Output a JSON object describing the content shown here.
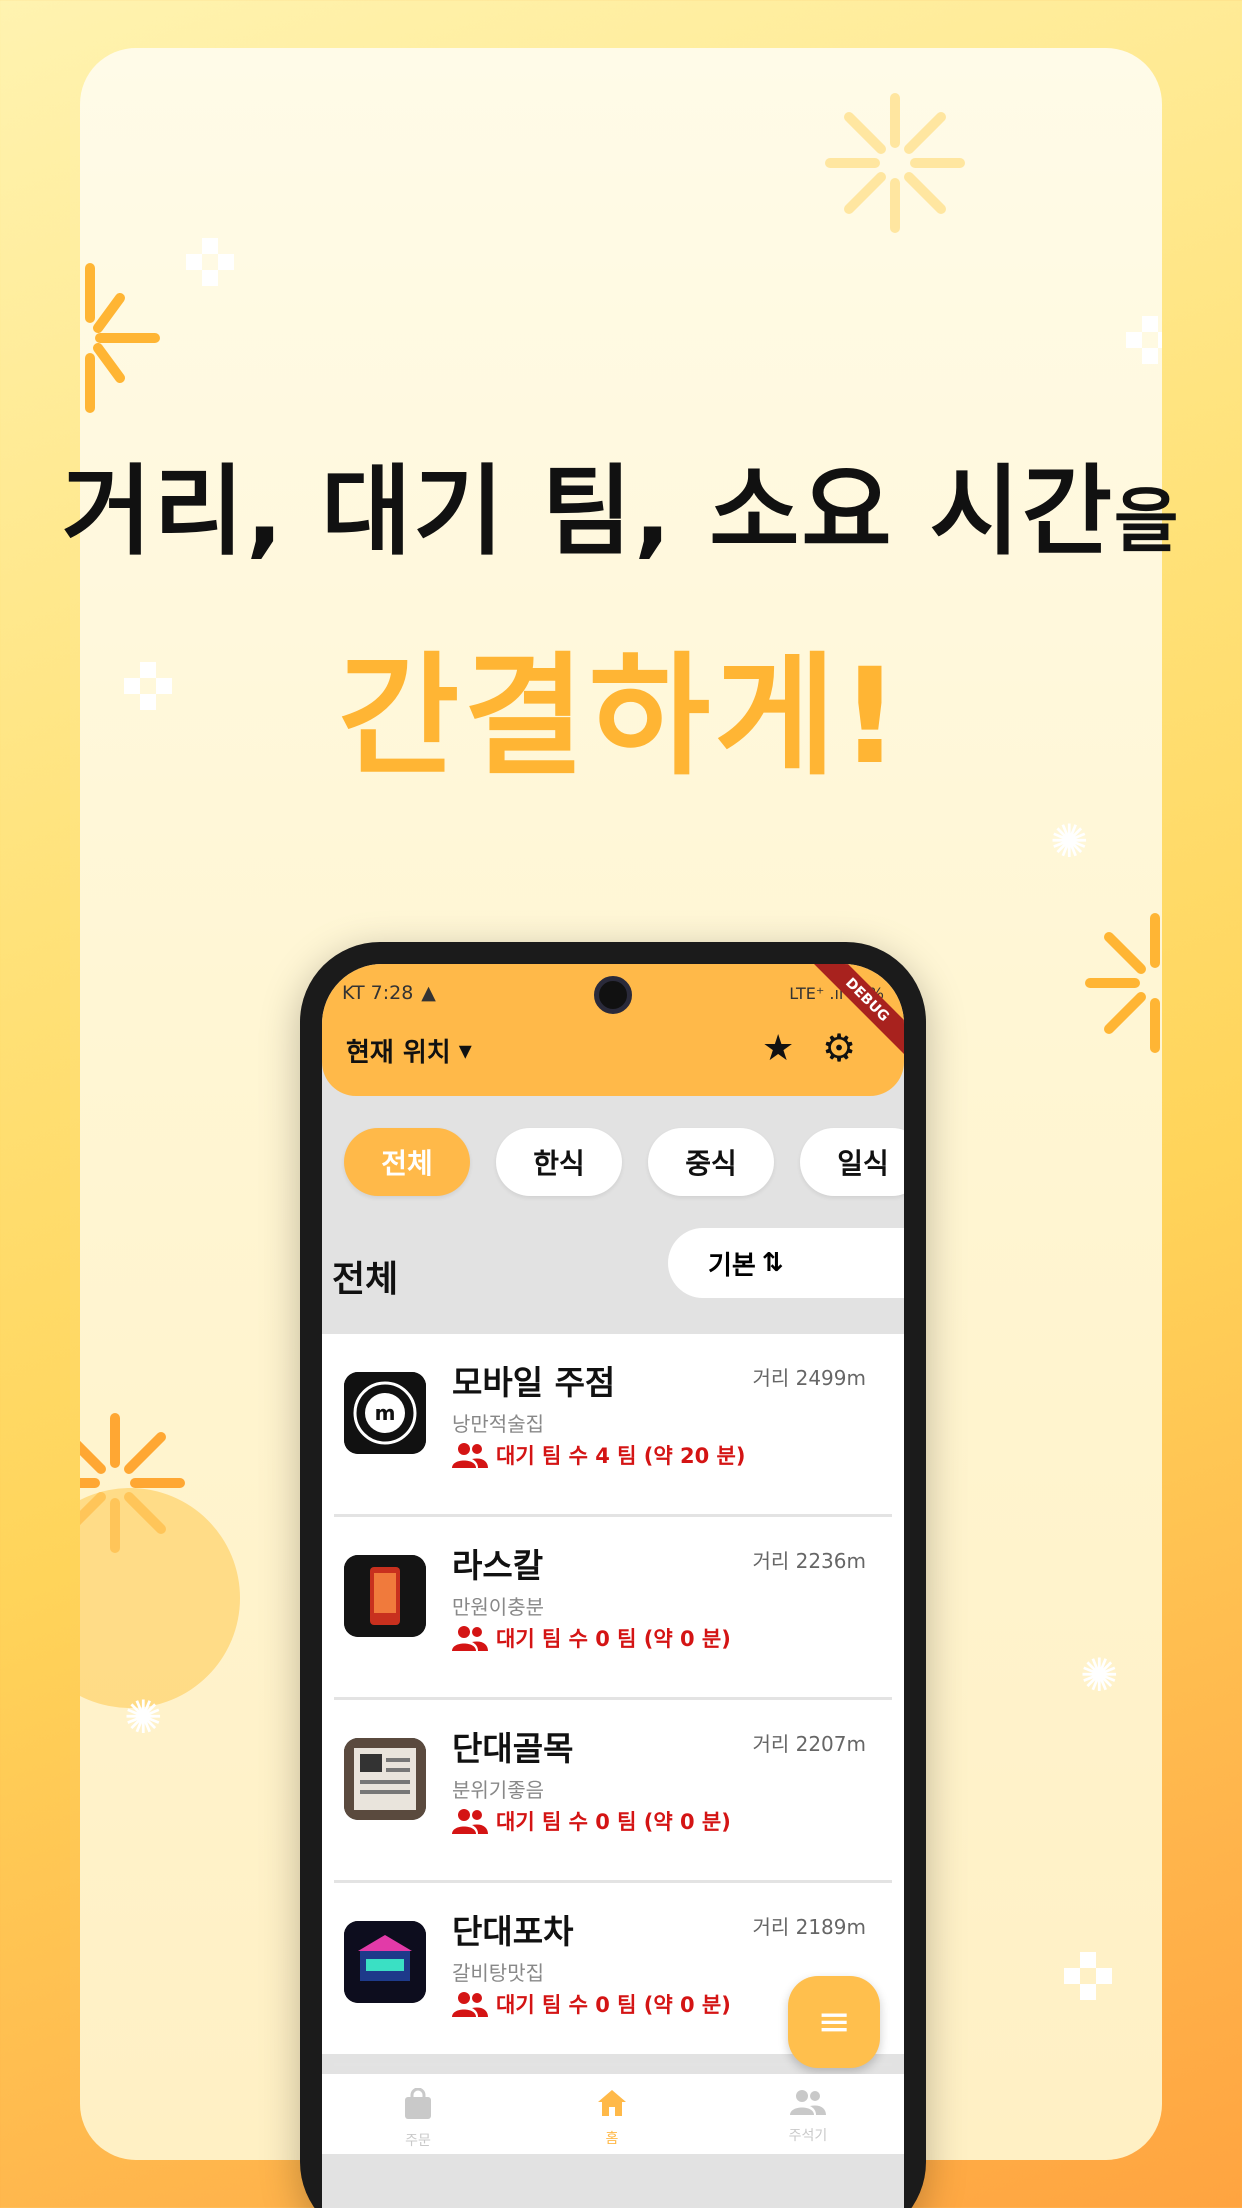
{
  "headline": {
    "line1_main": "거리, 대기 팀, 소요 시간",
    "line1_particle": "을",
    "line2": "간결하게!"
  },
  "phone": {
    "status": {
      "carrier_time": "KT 7:28",
      "right_text": "LTE⁺ .ıl 98%"
    },
    "debug_banner": "DEBUG",
    "appbar": {
      "location_label": "현재 위치",
      "location_arrow": "▾",
      "favorite_icon": "★",
      "settings_icon": "⚙"
    },
    "chips": [
      "전체",
      "한식",
      "중식",
      "일식"
    ],
    "section_title": "전체",
    "sort_label": "기본",
    "sort_icon": "⇅",
    "restaurants": [
      {
        "name": "모바일 주점",
        "distance": "거리 2499m",
        "category": "낭만적술집",
        "wait": "대기 팀 수 4 팀 (약 20 분)"
      },
      {
        "name": "라스칼",
        "distance": "거리 2236m",
        "category": "만원이충분",
        "wait": "대기 팀 수 0 팀 (약 0 분)"
      },
      {
        "name": "단대골목",
        "distance": "거리 2207m",
        "category": "분위기좋음",
        "wait": "대기 팀 수 0 팀 (약 0 분)"
      },
      {
        "name": "단대포차",
        "distance": "거리 2189m",
        "category": "갈비탕맛집",
        "wait": "대기 팀 수 0 팀 (약 0 분)"
      }
    ],
    "fab_icon": "≡",
    "bottom_nav": [
      {
        "icon": "bag-icon",
        "label": "주문"
      },
      {
        "icon": "home-icon",
        "label": "홈"
      },
      {
        "icon": "people-icon",
        "label": "주석기"
      }
    ],
    "colors": {
      "primary": "#ffb949",
      "wait_text": "#d41414"
    }
  }
}
